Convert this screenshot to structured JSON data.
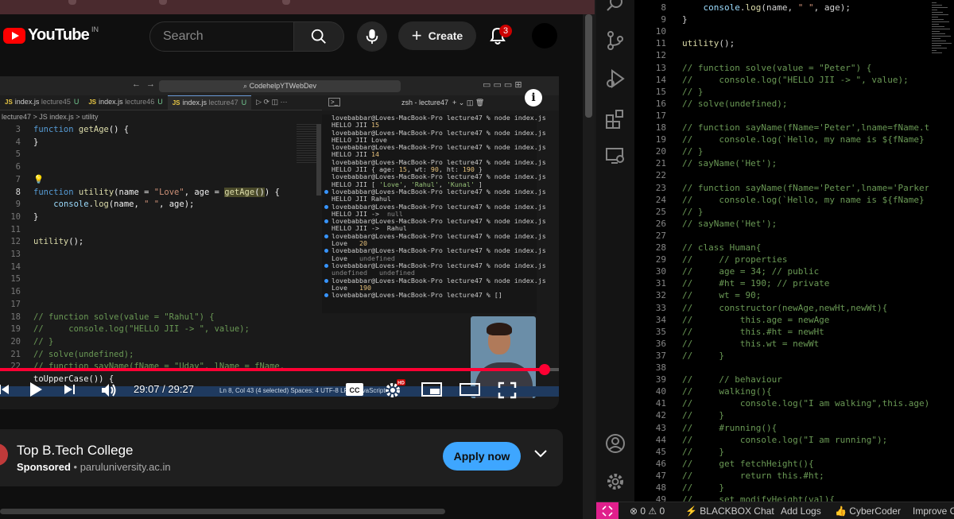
{
  "youtube": {
    "logo_word": "YouTube",
    "country": "IN",
    "search_placeholder": "Search",
    "create_label": "Create",
    "notification_count": "3"
  },
  "video": {
    "address": "CodehelpYTWebDev",
    "tabs": [
      {
        "label": "index.js",
        "dir": "lecture45",
        "status": "U"
      },
      {
        "label": "index.js",
        "dir": "lecture46",
        "status": "U"
      },
      {
        "label": "index.js",
        "dir": "lecture47",
        "status": "U"
      }
    ],
    "breadcrumb": "lecture47 > JS index.js > utility",
    "terminal_tab": "zsh - lecture47",
    "time": "29:07 / 29:27",
    "progress": 0.975,
    "status_bar": "Ln 8, Col 43 (4 selected)   Spaces: 4   UTF-8   LF   {} JavaScript",
    "code_lines": [
      {
        "n": "3",
        "t": "function getAge() {"
      },
      {
        "n": "4",
        "t": "}"
      },
      {
        "n": "5",
        "t": ""
      },
      {
        "n": "6",
        "t": ""
      },
      {
        "n": "7",
        "t": ""
      },
      {
        "n": "8",
        "t": "function utility(name = \"Love\", age = getAge()) {"
      },
      {
        "n": "9",
        "t": "    console.log(name, \" \", age);"
      },
      {
        "n": "10",
        "t": "}"
      },
      {
        "n": "11",
        "t": ""
      },
      {
        "n": "12",
        "t": "utility();"
      },
      {
        "n": "13",
        "t": ""
      },
      {
        "n": "14",
        "t": ""
      },
      {
        "n": "15",
        "t": ""
      },
      {
        "n": "16",
        "t": ""
      },
      {
        "n": "17",
        "t": ""
      },
      {
        "n": "18",
        "t": "// function solve(value = \"Rahul\") {"
      },
      {
        "n": "19",
        "t": "//     console.log(\"HELLO JII -> \", value);"
      },
      {
        "n": "20",
        "t": "// }"
      },
      {
        "n": "21",
        "t": "// solve(undefined);"
      },
      {
        "n": "22",
        "t": "// function sayName(fName = \"Uday\", lName = fName."
      },
      {
        "n": "",
        "t": "toUpperCase()) {"
      }
    ],
    "terminal": [
      "lovebabbar@Loves-MacBook-Pro lecture47 % node index.js",
      "HELLO JII 15",
      "lovebabbar@Loves-MacBook-Pro lecture47 % node index.js",
      "HELLO JII Love",
      "lovebabbar@Loves-MacBook-Pro lecture47 % node index.js",
      "HELLO JII 14",
      "lovebabbar@Loves-MacBook-Pro lecture47 % node index.js",
      "HELLO JII { age: 15, wt: 90, ht: 190 }",
      "lovebabbar@Loves-MacBook-Pro lecture47 % node index.js",
      "HELLO JII [ 'Love', 'Rahul', 'Kunal' ]",
      "lovebabbar@Loves-MacBook-Pro lecture47 % node index.js",
      "HELLO JII Rahul",
      "lovebabbar@Loves-MacBook-Pro lecture47 % node index.js",
      "HELLO JII ->  null",
      "lovebabbar@Loves-MacBook-Pro lecture47 % node index.js",
      "HELLO JII ->  Rahul",
      "lovebabbar@Loves-MacBook-Pro lecture47 % node index.js",
      "Love   20",
      "lovebabbar@Loves-MacBook-Pro lecture47 % node index.js",
      "Love   undefined",
      "lovebabbar@Loves-MacBook-Pro lecture47 % node index.js",
      "undefined   undefined",
      "lovebabbar@Loves-MacBook-Pro lecture47 % node index.js",
      "Love   190",
      "lovebabbar@Loves-MacBook-Pro lecture47 % []"
    ]
  },
  "ad": {
    "title": "Top B.Tech College",
    "sponsored": "Sponsored",
    "domain": "paruluniversity.ac.in",
    "cta": "Apply now"
  },
  "editor": {
    "lines": [
      {
        "n": "8",
        "t": "    console.log(name, \" \", age);",
        "comment": false
      },
      {
        "n": "9",
        "t": "}",
        "comment": false
      },
      {
        "n": "10",
        "t": "",
        "comment": false
      },
      {
        "n": "11",
        "t": "utility();",
        "comment": false
      },
      {
        "n": "12",
        "t": "",
        "comment": false
      },
      {
        "n": "13",
        "t": "// function solve(value = \"Peter\") {",
        "comment": true
      },
      {
        "n": "14",
        "t": "//     console.log(\"HELLO JII -> \", value);",
        "comment": true
      },
      {
        "n": "15",
        "t": "// }",
        "comment": true
      },
      {
        "n": "16",
        "t": "// solve(undefined);",
        "comment": true
      },
      {
        "n": "17",
        "t": "",
        "comment": false
      },
      {
        "n": "18",
        "t": "// function sayName(fName='Peter',lname=fName.toUp",
        "comment": true
      },
      {
        "n": "19",
        "t": "//     console.log(`Hello, my name is ${fName} ${l",
        "comment": true
      },
      {
        "n": "20",
        "t": "// }",
        "comment": true
      },
      {
        "n": "21",
        "t": "// sayName('Het');",
        "comment": true
      },
      {
        "n": "22",
        "t": "",
        "comment": false
      },
      {
        "n": "23",
        "t": "// function sayName(fName='Peter',lname='Parker'){",
        "comment": true
      },
      {
        "n": "24",
        "t": "//     console.log(`Hello, my name is ${fName} ${l",
        "comment": true
      },
      {
        "n": "25",
        "t": "// }",
        "comment": true
      },
      {
        "n": "26",
        "t": "// sayName('Het');",
        "comment": true
      },
      {
        "n": "27",
        "t": "",
        "comment": false
      },
      {
        "n": "28",
        "t": "// class Human{",
        "comment": true
      },
      {
        "n": "29",
        "t": "//     // properties",
        "comment": true
      },
      {
        "n": "30",
        "t": "//     age = 34; // public",
        "comment": true
      },
      {
        "n": "31",
        "t": "//     #ht = 190; // private",
        "comment": true
      },
      {
        "n": "32",
        "t": "//     wt = 90;",
        "comment": true
      },
      {
        "n": "33",
        "t": "//     constructor(newAge,newHt,newWt){",
        "comment": true
      },
      {
        "n": "34",
        "t": "//         this.age = newAge",
        "comment": true
      },
      {
        "n": "35",
        "t": "//         this.#ht = newHt",
        "comment": true
      },
      {
        "n": "36",
        "t": "//         this.wt = newWt",
        "comment": true
      },
      {
        "n": "37",
        "t": "//     }",
        "comment": true
      },
      {
        "n": "38",
        "t": "",
        "comment": false
      },
      {
        "n": "39",
        "t": "//     // behaviour",
        "comment": true
      },
      {
        "n": "40",
        "t": "//     walking(){",
        "comment": true
      },
      {
        "n": "41",
        "t": "//         console.log(\"I am walking\",this.age);",
        "comment": true
      },
      {
        "n": "42",
        "t": "//     }",
        "comment": true
      },
      {
        "n": "43",
        "t": "//     #running(){",
        "comment": true
      },
      {
        "n": "44",
        "t": "//         console.log(\"I am running\");",
        "comment": true
      },
      {
        "n": "45",
        "t": "//     }",
        "comment": true
      },
      {
        "n": "46",
        "t": "//     get fetchHeight(){",
        "comment": true
      },
      {
        "n": "47",
        "t": "//         return this.#ht;",
        "comment": true
      },
      {
        "n": "48",
        "t": "//     }",
        "comment": true
      },
      {
        "n": "49",
        "t": "//     set modifyHeight(val){",
        "comment": true
      }
    ]
  },
  "statusbar": {
    "problems": "⊗ 0 ⚠ 0",
    "blackbox": "BLACKBOX Chat",
    "add_logs": "Add Logs",
    "cybercoder": "CyberCoder",
    "improve": "Improve Code"
  },
  "colors": {
    "youtube_red": "#ff0000",
    "progress_red": "#ff0033",
    "apply_blue": "#3ea6ff",
    "remote_pink": "#e01f8c",
    "comment_green": "#6a9955"
  }
}
